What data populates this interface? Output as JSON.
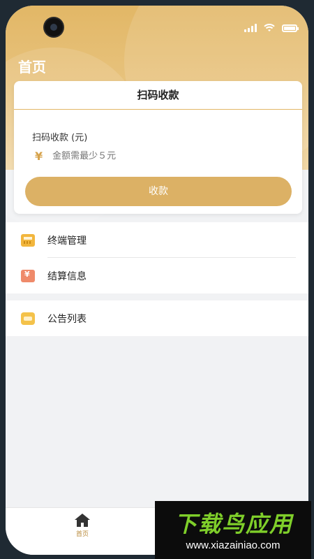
{
  "header": {
    "title": "首页"
  },
  "collect_card": {
    "title": "扫码收款",
    "field_label": "扫码收款 (元)",
    "currency_symbol": "¥",
    "amount_placeholder": "金额需最少５元",
    "button_label": "收款"
  },
  "menu": {
    "group1": [
      {
        "label": "终端管理",
        "icon": "terminal-icon"
      },
      {
        "label": "结算信息",
        "icon": "settlement-icon"
      }
    ],
    "group2": [
      {
        "label": "公告列表",
        "icon": "notice-icon"
      }
    ]
  },
  "tabbar": {
    "home_label": "首页"
  },
  "watermark": {
    "title": "下载鸟应用",
    "url": "www.xiazainiao.com"
  },
  "colors": {
    "accent": "#dcb165",
    "header_gradient_top": "#e2b766"
  }
}
